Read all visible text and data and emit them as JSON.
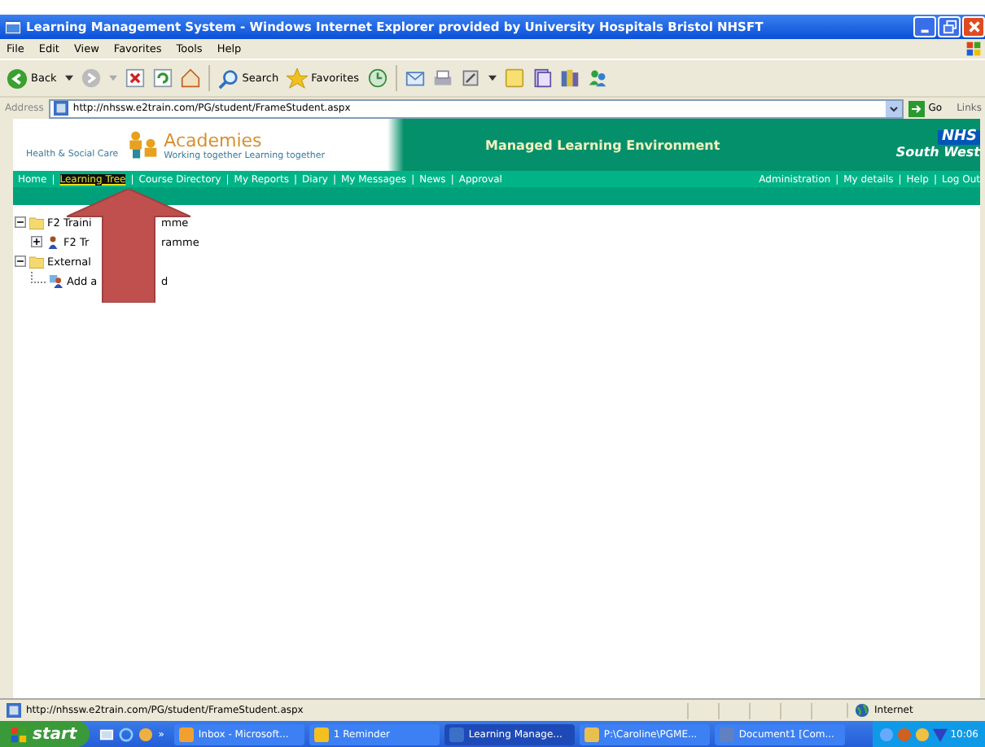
{
  "window": {
    "title": "Learning Management System - Windows Internet Explorer provided by University Hospitals Bristol NHSFT"
  },
  "menu": [
    "File",
    "Edit",
    "View",
    "Favorites",
    "Tools",
    "Help"
  ],
  "toolbar": {
    "back": "Back",
    "search": "Search",
    "favorites": "Favorites"
  },
  "address": {
    "label": "Address",
    "value": "http://nhssw.e2train.com/PG/student/FrameStudent.aspx",
    "go": "Go",
    "links": "Links"
  },
  "header": {
    "brand": "Academies",
    "brand_left": "Health & Social Care",
    "tagline": "Working together Learning together",
    "title": "Managed Learning Environment",
    "nhs": "NHS",
    "region": "South West"
  },
  "nav_left": [
    {
      "label": "Home",
      "selected": false
    },
    {
      "label": "Learning Tree",
      "selected": true
    },
    {
      "label": "Course Directory",
      "selected": false
    },
    {
      "label": "My Reports",
      "selected": false
    },
    {
      "label": "Diary",
      "selected": false
    },
    {
      "label": "My Messages",
      "selected": false
    },
    {
      "label": "News",
      "selected": false
    },
    {
      "label": "Approval",
      "selected": false
    }
  ],
  "nav_right": [
    "Administration",
    "My details",
    "Help",
    "Log Out"
  ],
  "nav_separator": "|",
  "tree": [
    {
      "kind": "folder",
      "expanded": true,
      "parts": [
        "F2 Traini",
        "mme"
      ],
      "children": [
        {
          "kind": "person",
          "expanded": false,
          "parts": [
            "F2 Tr",
            "ramme"
          ]
        }
      ]
    },
    {
      "kind": "folder",
      "expanded": true,
      "parts": [
        "External"
      ],
      "children": [
        {
          "kind": "add",
          "parts": [
            "Add a",
            "d"
          ]
        }
      ]
    }
  ],
  "status_bar": {
    "url": "http://nhssw.e2train.com/PG/student/FrameStudent.aspx",
    "zone": "Internet"
  },
  "taskbar": {
    "start": "start",
    "more": "»",
    "tasks": [
      {
        "label": "Inbox - Microsoft...",
        "selected": false
      },
      {
        "label": "1 Reminder",
        "selected": false
      },
      {
        "label": "Learning Manage...",
        "selected": true
      },
      {
        "label": "P:\\Caroline\\PGME...",
        "selected": false
      },
      {
        "label": "Document1 [Com...",
        "selected": false
      }
    ],
    "clock": "10:06"
  }
}
